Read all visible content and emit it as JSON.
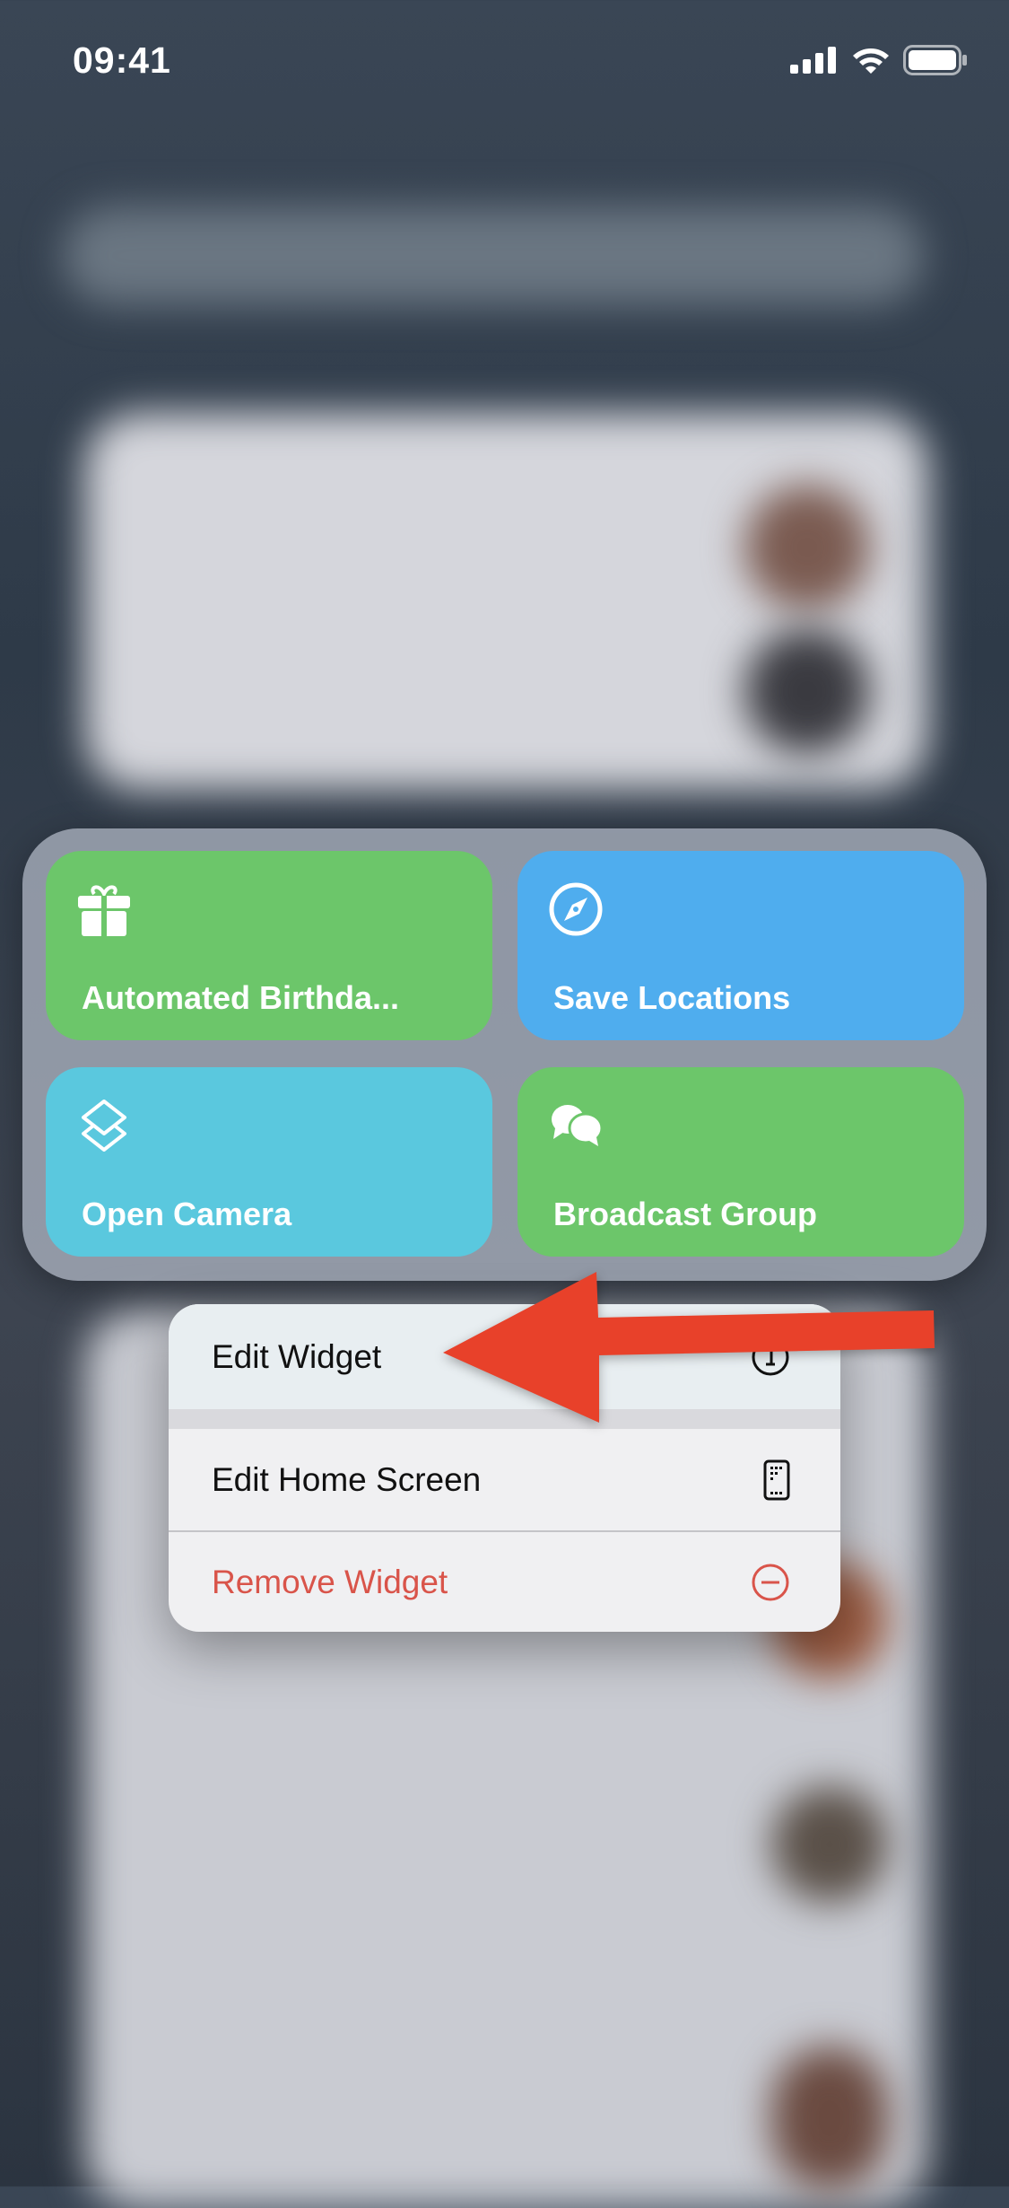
{
  "status_bar": {
    "time": "09:41",
    "icons": [
      "cellular-signal-icon",
      "wifi-icon",
      "battery-icon"
    ]
  },
  "widget": {
    "tiles": [
      {
        "label": "Automated Birthda...",
        "icon": "gift-icon",
        "color": "#6cc66a"
      },
      {
        "label": "Save Locations",
        "icon": "compass-icon",
        "color": "#4fadee"
      },
      {
        "label": "Open Camera",
        "icon": "shortcuts-icon",
        "color": "#5ac8de"
      },
      {
        "label": "Broadcast Group",
        "icon": "chat-bubbles-icon",
        "color": "#6cc66a"
      }
    ]
  },
  "context_menu": {
    "items": [
      {
        "label": "Edit Widget",
        "icon": "info-icon"
      },
      {
        "label": "Edit Home Screen",
        "icon": "phone-apps-icon"
      },
      {
        "label": "Remove Widget",
        "icon": "minus-circle-icon",
        "color": "#d9544a"
      }
    ]
  },
  "annotation": {
    "icon": "red-arrow-icon",
    "color": "#e8412a"
  }
}
